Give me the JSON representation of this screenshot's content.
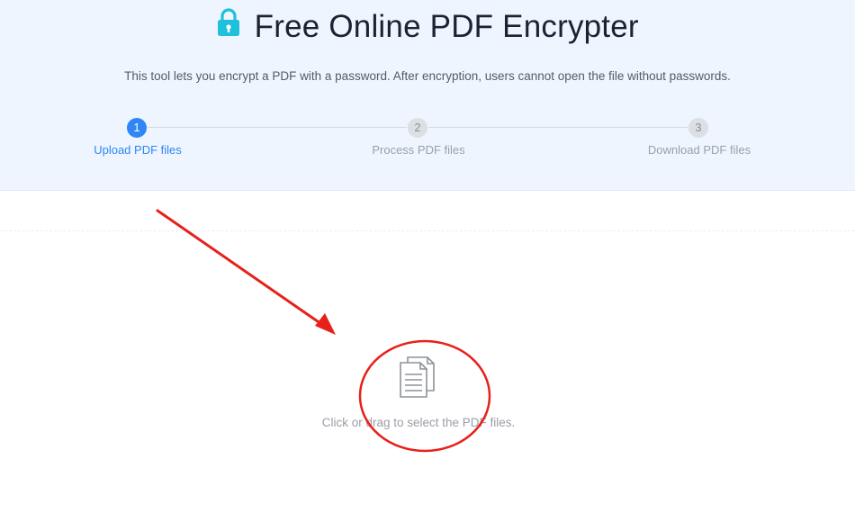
{
  "header": {
    "title": "Free Online PDF Encrypter",
    "lock_icon": "lock-icon",
    "description": "This tool lets you encrypt a PDF with a password. After encryption, users cannot open the file without passwords."
  },
  "steps": [
    {
      "number": "1",
      "label": "Upload PDF files",
      "state": "active"
    },
    {
      "number": "2",
      "label": "Process PDF files",
      "state": "pending"
    },
    {
      "number": "3",
      "label": "Download PDF files",
      "state": "pending"
    }
  ],
  "upload": {
    "icon": "documents-icon",
    "hint": "Click or drag to select the PDF files."
  },
  "annotation": {
    "color": "#e8201a",
    "shapes": [
      "arrow",
      "ellipse"
    ]
  },
  "colors": {
    "accent": "#2f86f6",
    "lock": "#1fc0dc",
    "hero_bg": "#eef5fe"
  }
}
